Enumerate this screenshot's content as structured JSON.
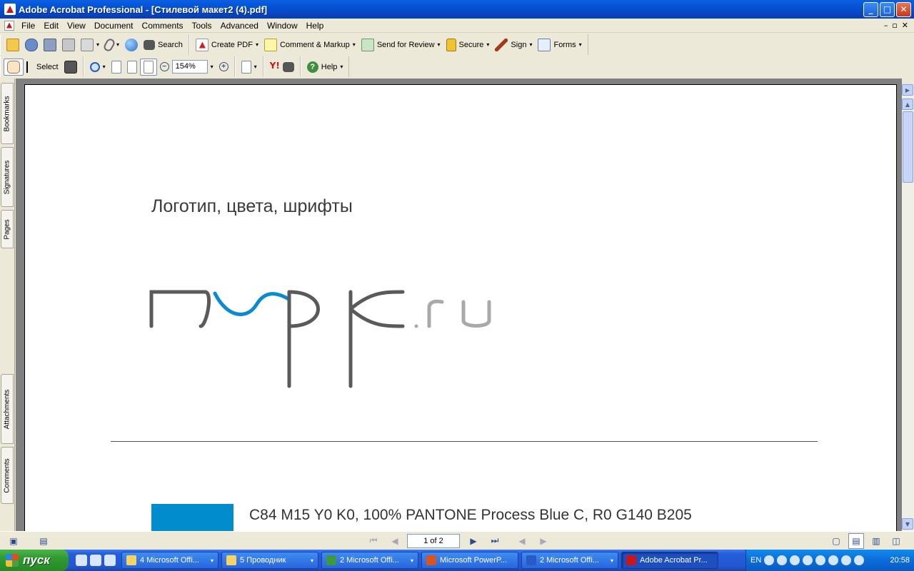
{
  "window": {
    "title": "Adobe Acrobat Professional - [Стилевой макет2 (4).pdf]",
    "min_label": "_",
    "max_label": "□",
    "close_label": "✕"
  },
  "menubar": {
    "items": [
      "File",
      "Edit",
      "View",
      "Document",
      "Comments",
      "Tools",
      "Advanced",
      "Window",
      "Help"
    ],
    "doc_controls": [
      "–",
      "▫",
      "✕"
    ]
  },
  "toolbar1": {
    "search_label": "Search",
    "create_pdf_label": "Create PDF",
    "comment_label": "Comment & Markup",
    "send_review_label": "Send for Review",
    "secure_label": "Secure",
    "sign_label": "Sign",
    "forms_label": "Forms"
  },
  "toolbar2": {
    "select_label": "Select",
    "zoom_value": "154%",
    "zoom_out_glyph": "−",
    "zoom_in_glyph": "+",
    "yahoo_label": "Y!",
    "help_label": "Help",
    "help_glyph": "?"
  },
  "leftnav": {
    "tabs": [
      "Bookmarks",
      "Signatures",
      "Pages",
      "Attachments",
      "Comments"
    ]
  },
  "document": {
    "heading": "Логотип, цвета, шрифты",
    "logo_suffix": ".ru",
    "swatch_color": "#008ccd",
    "color_spec": "C84 M15 Y0 K0, 100% PANTONE Process Blue C, R0 G140 B205",
    "colors": {
      "logo_gray": "#5a5a5a",
      "logo_blue": "#0a8acf",
      "logo_light_gray": "#a9a9a9"
    }
  },
  "statusbar": {
    "page_indicator": "1 of 2",
    "first": "⏮",
    "prev": "◀",
    "next": "▶",
    "last": "⏭"
  },
  "taskbar": {
    "start_label": "пуск",
    "tasks": [
      {
        "label": "4 Microsoft Offi...",
        "active": false
      },
      {
        "label": "5 Проводник",
        "active": false
      },
      {
        "label": "2 Microsoft Offi...",
        "active": false
      },
      {
        "label": "Microsoft PowerP...",
        "active": false
      },
      {
        "label": "2 Microsoft Offi...",
        "active": false
      },
      {
        "label": "Adobe Acrobat Pr...",
        "active": true
      }
    ],
    "language": "EN",
    "clock": "20:58"
  }
}
